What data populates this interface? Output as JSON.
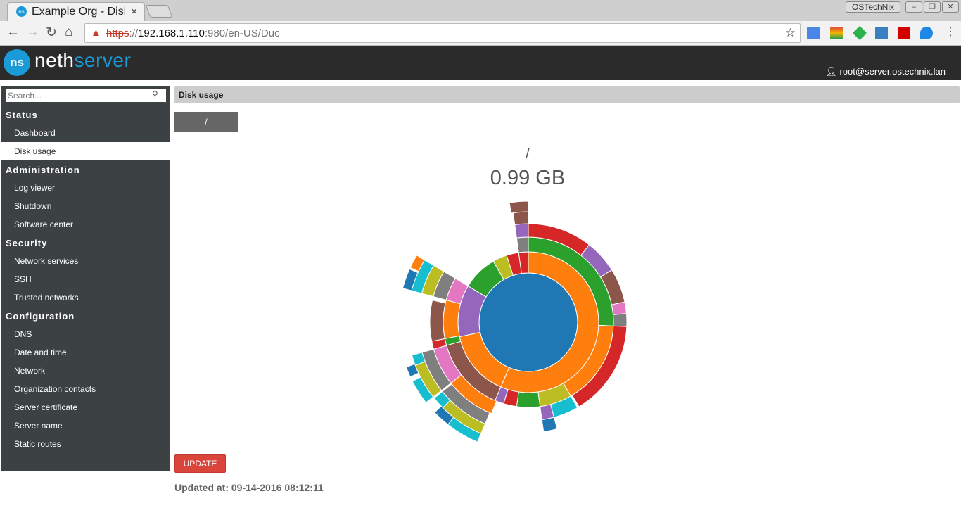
{
  "browser": {
    "tab_title": "Example Org - Disk usage",
    "tab_close": "×",
    "profile": "OSTechNix",
    "url": {
      "scheme": "https",
      "sep": "://",
      "host": "192.168.1.110",
      "rest": ":980/en-US/Duc"
    },
    "extensions": [
      "google-translate",
      "chrome-download",
      "feedly",
      "scribd",
      "flipboard",
      "vivaldi"
    ]
  },
  "header": {
    "brand_a": "neth",
    "brand_b": "server",
    "logo": "ns",
    "user": "root@server.ostechnix.lan"
  },
  "sidebar": {
    "search_placeholder": "Search...",
    "sections": [
      {
        "title": "Status",
        "items": [
          "Dashboard",
          "Disk usage"
        ]
      },
      {
        "title": "Administration",
        "items": [
          "Log viewer",
          "Shutdown",
          "Software center"
        ]
      },
      {
        "title": "Security",
        "items": [
          "Network services",
          "SSH",
          "Trusted networks"
        ]
      },
      {
        "title": "Configuration",
        "items": [
          "DNS",
          "Date and time",
          "Network",
          "Organization contacts",
          "Server certificate",
          "Server name",
          "Static routes"
        ]
      }
    ],
    "active": "Disk usage"
  },
  "main": {
    "title": "Disk usage",
    "path_button": "/",
    "chart_path": "/",
    "chart_size": "0.99 GB",
    "update_label": "UPDATE",
    "updated_at": "Updated at: 09-14-2016 08:12:11"
  },
  "colors": {
    "accent": "#1a9ad6",
    "update": "#d9453a",
    "blue": "#1f77b4",
    "orange": "#ff7f0e",
    "green": "#2ca02c",
    "red": "#d62728",
    "purple": "#9467bd",
    "brown": "#8c564b",
    "pink": "#e377c2",
    "grey": "#7f7f7f",
    "olive": "#bcbd22",
    "cyan": "#17becf"
  },
  "chart_data": {
    "type": "sunburst",
    "unit": "percent of total",
    "segments": [
      [
        0,
        0,
        100,
        "blue"
      ],
      [
        1,
        0,
        56.4,
        "orange"
      ],
      [
        1,
        56.4,
        71.7,
        "orange"
      ],
      [
        1,
        71.7,
        83.6,
        "purple"
      ],
      [
        1,
        83.6,
        91.7,
        "green"
      ],
      [
        1,
        91.7,
        95,
        "olive"
      ],
      [
        1,
        95,
        97.8,
        "red"
      ],
      [
        1,
        97.8,
        100,
        "red"
      ],
      [
        2,
        0,
        25.7,
        "green"
      ],
      [
        2,
        25.7,
        41.7,
        "orange"
      ],
      [
        2,
        41.7,
        47.8,
        "olive"
      ],
      [
        2,
        47.8,
        52.2,
        "green"
      ],
      [
        2,
        52.2,
        54.7,
        "red"
      ],
      [
        2,
        54.7,
        56.4,
        "purple"
      ],
      [
        2,
        56.4,
        70.6,
        "brown"
      ],
      [
        2,
        70.6,
        71.9,
        "green"
      ],
      [
        2,
        71.9,
        79.2,
        "orange"
      ],
      [
        2,
        79.2,
        83.6,
        "pink"
      ],
      [
        2,
        97.8,
        100,
        "grey"
      ],
      [
        3,
        0,
        10.6,
        "red"
      ],
      [
        3,
        10.6,
        16.1,
        "purple"
      ],
      [
        3,
        16.1,
        21.7,
        "brown"
      ],
      [
        3,
        21.7,
        23.6,
        "pink"
      ],
      [
        3,
        23.6,
        25.7,
        "grey"
      ],
      [
        3,
        25.7,
        41.4,
        "red"
      ],
      [
        3,
        41.7,
        45.8,
        "cyan"
      ],
      [
        3,
        45.8,
        47.8,
        "purple"
      ],
      [
        3,
        56.1,
        64.4,
        "orange"
      ],
      [
        3,
        64.4,
        70.6,
        "pink"
      ],
      [
        3,
        70.6,
        71.9,
        "red"
      ],
      [
        3,
        71.9,
        78.6,
        "brown"
      ],
      [
        3,
        79.2,
        83.6,
        "grey"
      ],
      [
        3,
        97.8,
        100,
        "purple"
      ],
      [
        4,
        45.8,
        47.8,
        "blue"
      ],
      [
        4,
        56.4,
        64.2,
        "grey"
      ],
      [
        4,
        64.4,
        70.6,
        "grey"
      ],
      [
        4,
        79.2,
        83.6,
        "olive"
      ],
      [
        4,
        97.8,
        100,
        "brown"
      ],
      [
        5,
        56.4,
        62.5,
        "olive"
      ],
      [
        5,
        62.5,
        64.2,
        "cyan"
      ],
      [
        5,
        64.4,
        69.2,
        "olive"
      ],
      [
        5,
        69.2,
        70.6,
        "cyan"
      ],
      [
        5,
        79.2,
        83.6,
        "cyan"
      ],
      [
        5,
        97.5,
        100,
        "brown"
      ],
      [
        6,
        56.4,
        60.6,
        "cyan"
      ],
      [
        6,
        60.6,
        62.8,
        "blue"
      ],
      [
        6,
        64.4,
        67.5,
        "cyan"
      ],
      [
        6,
        68.1,
        69.4,
        "blue"
      ],
      [
        6,
        79.2,
        81.7,
        "blue"
      ],
      [
        6,
        81.9,
        83.6,
        "orange"
      ]
    ]
  }
}
